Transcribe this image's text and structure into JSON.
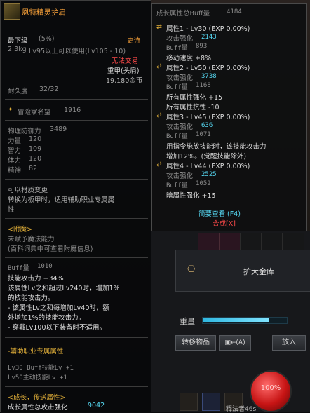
{
  "item": {
    "name": "恩特精灵护肩",
    "grade": "最下级",
    "grade_pct": "(5%)",
    "rarity": "史诗",
    "weight": "2.3kg",
    "level_req": "Lv95以上可以使用(Lv105 - 10)",
    "trade": "无法交易",
    "type": "重甲(头肩)",
    "price": "19,180金币",
    "durability_label": "耐久度",
    "durability": "32/32",
    "fame_label": "冒险家名望",
    "fame": "1916",
    "stats": [
      {
        "label": "物理防御力",
        "value": "3489"
      },
      {
        "label": "力量",
        "value": "120"
      },
      {
        "label": "智力",
        "value": "109"
      },
      {
        "label": "体力",
        "value": "120"
      },
      {
        "label": "精神",
        "value": "82"
      }
    ],
    "convert_title": "可以材质变更",
    "convert_desc1": "转换为板甲时，适用辅助职业专属属",
    "convert_desc2": "性",
    "enchant_title": "<附魔>",
    "enchant_line1": "未赋予魔法能力",
    "enchant_line2": "(百科词典中可查看附魔信息)",
    "buff_label": "Buff量",
    "buff_value": "1010",
    "skill_attack": "技能攻击力 +34%",
    "desc": [
      "该属性Lv之和超过Lv240时，增加1%",
      "的技能攻击力。",
      "- 该属性Lv之和每增加Lv40时，额",
      "外增加1%的技能攻击力。",
      "- 穿戴Lv100以下装备时不适用。"
    ],
    "support_title": "-辅助职业专属属性",
    "support_line1": "Lv30 Buff技能Lv +1",
    "support_line2": "Lv50主动技能Lv +1",
    "growth_title": "<成长，传送属性>",
    "growth_line": "成长属性总攻击强化",
    "growth_value": "9042"
  },
  "buff_tooltip": {
    "title": "成长属性总Buff量",
    "title_value": "4184",
    "attrs": [
      {
        "name": "属性1 - Lv30 (EXP 0.00%)",
        "attack_label": "攻击强化",
        "attack": "2143",
        "buff_label": "Buff量",
        "buff": "893",
        "effects": [
          "移动速度 +8%"
        ]
      },
      {
        "name": "属性2 - Lv50 (EXP 0.00%)",
        "attack_label": "攻击强化",
        "attack": "3738",
        "buff_label": "Buff量",
        "buff": "1168",
        "effects": [
          "所有属性强化 +15",
          "所有属性抗性 -10"
        ]
      },
      {
        "name": "属性3 - Lv45 (EXP 0.00%)",
        "attack_label": "攻击强化",
        "attack": "636",
        "buff_label": "Buff量",
        "buff": "1071",
        "effects": [
          "用指令施放技能时，该技能攻击力",
          "增加12%。(觉醒技能除外)"
        ]
      },
      {
        "name": "属性4 - Lv44 (EXP 0.00%)",
        "attack_label": "攻击强化",
        "attack": "2525",
        "buff_label": "Buff量",
        "buff": "1052",
        "effects": [
          "暗属性强化 +15"
        ]
      }
    ],
    "simple_view": "简要查看 (F4)",
    "synthesis": "合成[X]"
  },
  "inventory": {
    "expand_label": "扩大金库",
    "weight_label": "重量",
    "weight_fill": 0.8,
    "transfer_button": "转移物品",
    "auto_label": "(A)",
    "put_button": "放入",
    "hp_percent": "100%",
    "bottom_text": "释法者46s"
  },
  "colors": {
    "rarity": "#ffa53a",
    "accent_cyan": "#55d6f0",
    "trade_red": "#ff4a4a"
  }
}
